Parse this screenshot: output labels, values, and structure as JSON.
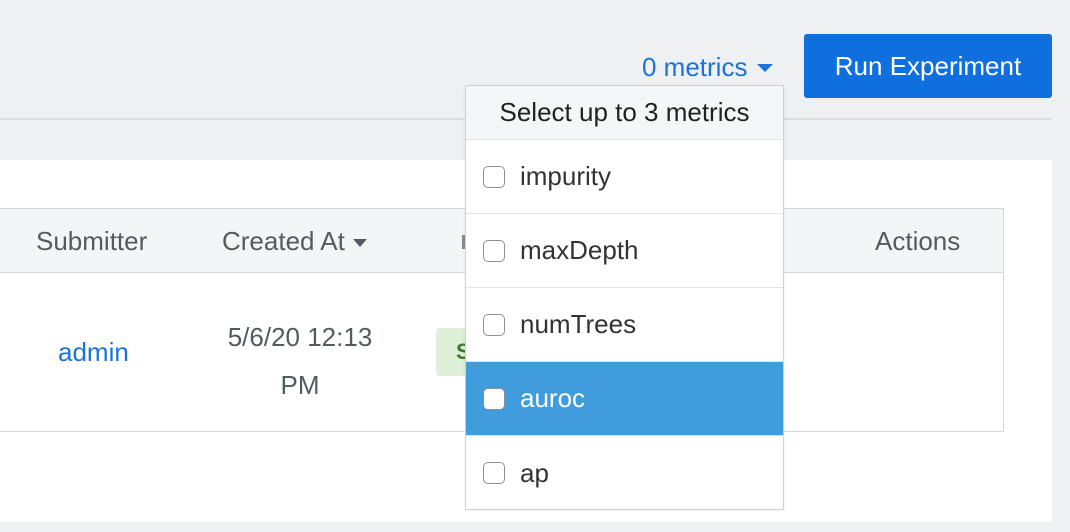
{
  "toolbar": {
    "metrics_toggle_label": "0 metrics",
    "run_button_label": "Run Experiment"
  },
  "table": {
    "columns": {
      "submitter": "Submitter",
      "created_at": "Created At",
      "actions": "Actions"
    },
    "rows": [
      {
        "submitter": "admin",
        "created_at": "5/6/20 12:13 PM",
        "status": "S"
      }
    ]
  },
  "metrics_dropdown": {
    "header": "Select up to 3 metrics",
    "options": [
      {
        "label": "impurity",
        "checked": false,
        "highlighted": false
      },
      {
        "label": "maxDepth",
        "checked": false,
        "highlighted": false
      },
      {
        "label": "numTrees",
        "checked": false,
        "highlighted": false
      },
      {
        "label": "auroc",
        "checked": false,
        "highlighted": true
      },
      {
        "label": "ap",
        "checked": false,
        "highlighted": false
      }
    ]
  },
  "colors": {
    "accent": "#0f6fde",
    "link": "#1a73d9",
    "highlight": "#409cdd",
    "background": "#eff0f2"
  }
}
